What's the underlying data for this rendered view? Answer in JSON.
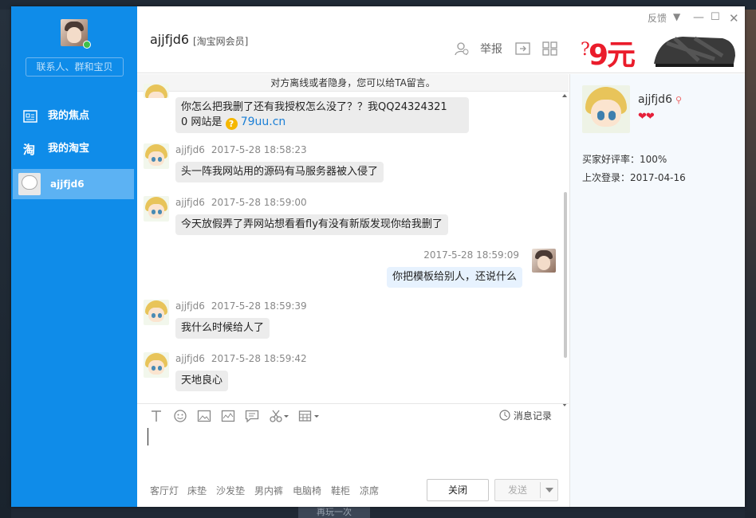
{
  "background": {
    "top_text": "",
    "replay_button": "再玩一次"
  },
  "sidebar": {
    "search_placeholder": "联系人、群和宝贝",
    "nav": [
      {
        "label": "我的焦点",
        "icon": "focus-icon"
      },
      {
        "label": "我的淘宝",
        "icon": "taobao-icon"
      }
    ],
    "active_contact": "ajjfjd6"
  },
  "header": {
    "contact_name": "ajjfjd6",
    "member_tag": "[淘宝网会员]",
    "report_label": "举报",
    "feedback_label": "反馈",
    "ad": {
      "question": "?",
      "price": "9元"
    }
  },
  "chat": {
    "notice": "对方离线或者隐身，您可以给TA留言。",
    "messages": [
      {
        "sender": "ajjfjd6",
        "time": "",
        "text": "你怎么把我删了还有我授权怎么没了？？我QQ24324321",
        "text2": "0  网站是 ",
        "link": "79uu.cn",
        "mine": false
      },
      {
        "sender": "ajjfjd6",
        "time": "2017-5-28 18:58:23",
        "text": "头一阵我网站用的源码有马服务器被入侵了",
        "mine": false
      },
      {
        "sender": "ajjfjd6",
        "time": "2017-5-28 18:59:00",
        "text": "今天放假弄了弄网站想看看fly有没有新版发现你给我删了",
        "mine": false
      },
      {
        "sender": "me",
        "time": "2017-5-28 18:59:09",
        "text": "你把模板给别人，还说什么",
        "mine": true
      },
      {
        "sender": "ajjfjd6",
        "time": "2017-5-28 18:59:39",
        "text": "我什么时候给人了",
        "mine": false
      },
      {
        "sender": "ajjfjd6",
        "time": "2017-5-28 18:59:42",
        "text": "天地良心",
        "mine": false
      }
    ]
  },
  "input": {
    "history_label": "消息记录",
    "suggestions": [
      "客厅灯",
      "床垫",
      "沙发垫",
      "男内裤",
      "电脑椅",
      "鞋柜",
      "凉席"
    ],
    "close_label": "关闭",
    "send_label": "发送"
  },
  "info_panel": {
    "name": "ajjfjd6",
    "rating_label": "买家好评率：",
    "rating_value": "100%",
    "last_login_label": "上次登录：",
    "last_login_value": "2017-04-16",
    "hearts": "❤❤"
  },
  "colors": {
    "sidebar": "#0f8ce9",
    "sidebar_active": "#5cb2f3",
    "link": "#1a7fd6",
    "price": "#ea1c2b"
  }
}
